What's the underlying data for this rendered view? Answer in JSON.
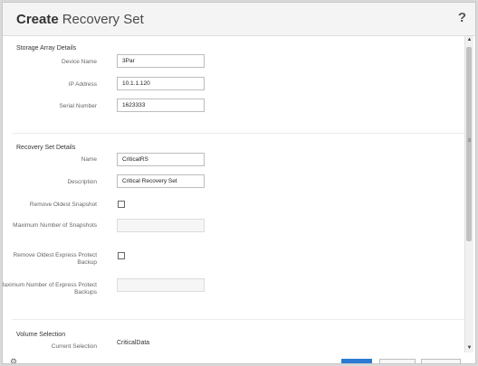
{
  "dialog": {
    "title_bold": "Create",
    "title_rest": "Recovery Set",
    "help": "?"
  },
  "storage": {
    "section_title": "Storage Array Details",
    "device_name_label": "Device Name",
    "device_name_value": "3Par",
    "ip_label": "IP Address",
    "ip_value": "10.1.1.120",
    "serial_label": "Serial Number",
    "serial_value": "1623333"
  },
  "recovery": {
    "section_title": "Recovery Set Details",
    "name_label": "Name",
    "name_value": "CriticalRS",
    "description_label": "Description",
    "description_value": "Critical Recovery Set",
    "remove_oldest_label": "Remove Oldest Snapshot",
    "max_snapshots_label": "Maximum Number of Snapshots",
    "remove_oldest_express_label": "Remove Oldest Express Protect Backup",
    "max_express_label": "Maximum Number of Express Protect Backups"
  },
  "volume": {
    "section_title": "Volume Selection",
    "current_selection_label": "Current Selection",
    "current_selection_value": "CriticalData"
  },
  "scrollbar": {
    "up": "▲",
    "down": "▼",
    "grip": "≡"
  },
  "colors": {
    "primary_button": "#2d7ad2",
    "titlebar": "#f4f4f4"
  }
}
